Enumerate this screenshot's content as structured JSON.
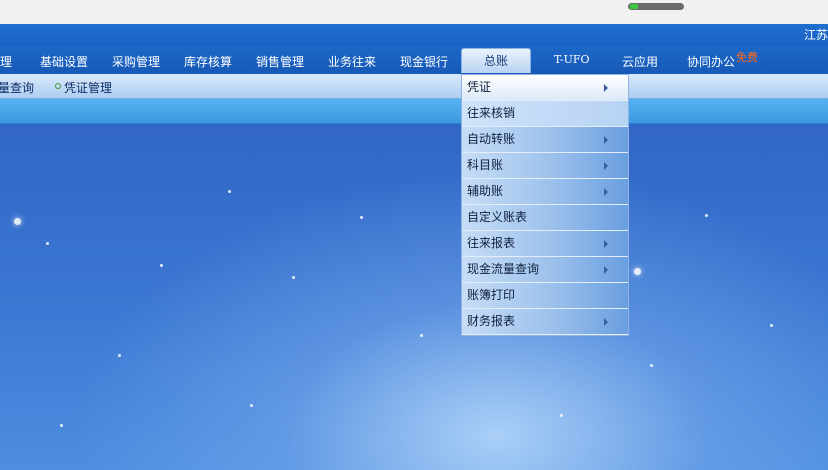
{
  "window": {
    "corner_text": "江苏"
  },
  "progress": {
    "value": 0.15
  },
  "menu": {
    "items": [
      {
        "label": "管理"
      },
      {
        "label": "基础设置"
      },
      {
        "label": "采购管理"
      },
      {
        "label": "库存核算"
      },
      {
        "label": "销售管理"
      },
      {
        "label": "业务往来"
      },
      {
        "label": "现金银行"
      },
      {
        "label": "总账"
      },
      {
        "label": "T-UFO"
      },
      {
        "label": "云应用"
      },
      {
        "label": "协同办公"
      }
    ],
    "active_index": 7,
    "badge": "免费"
  },
  "subnav": {
    "items": [
      {
        "label": "存量查询"
      },
      {
        "label": "凭证管理"
      }
    ]
  },
  "dropdown": {
    "items": [
      {
        "label": "凭证",
        "has_submenu": true
      },
      {
        "label": "往来核销",
        "has_submenu": false
      },
      {
        "label": "自动转账",
        "has_submenu": true
      },
      {
        "label": "科目账",
        "has_submenu": true
      },
      {
        "label": "辅助账",
        "has_submenu": true
      },
      {
        "label": "自定义账表",
        "has_submenu": false
      },
      {
        "label": "往来报表",
        "has_submenu": true
      },
      {
        "label": "现金流量查询",
        "has_submenu": true
      },
      {
        "label": "账簿打印",
        "has_submenu": false
      },
      {
        "label": "财务报表",
        "has_submenu": true
      }
    ]
  },
  "colors": {
    "accent": "#1a63c4",
    "badge": "#ff6a1a"
  }
}
